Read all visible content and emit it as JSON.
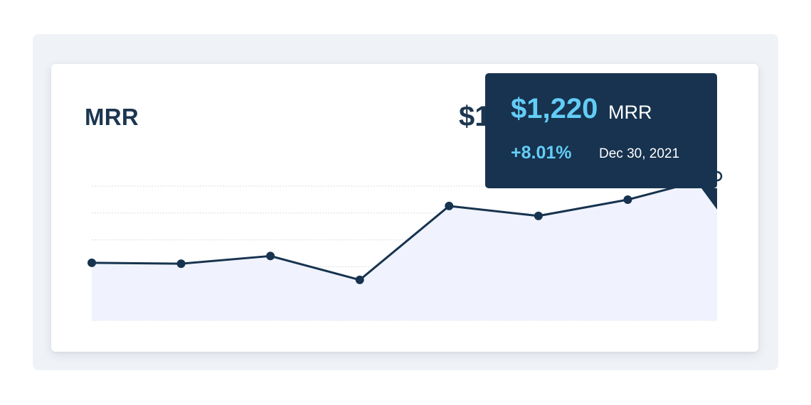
{
  "card": {
    "title": "MRR",
    "headline_value": "$1"
  },
  "tooltip": {
    "value": "$1,220",
    "unit": "MRR",
    "change": "+8.01%",
    "date": "Dec 30, 2021"
  },
  "colors": {
    "line": "#17334f",
    "area": "#eef2fd",
    "grid": "#d7dbe2",
    "tooltip_bg": "#17334f",
    "accent": "#63cdf6"
  },
  "chart_data": {
    "type": "area",
    "title": "MRR",
    "xlabel": "",
    "ylabel": "",
    "grid": true,
    "series": [
      {
        "values": [
          1028,
          1026,
          1043,
          990,
          1154,
          1132,
          1168,
          1220
        ]
      }
    ],
    "ylim": [
      900,
      1280
    ],
    "highlighted_index": 7
  }
}
